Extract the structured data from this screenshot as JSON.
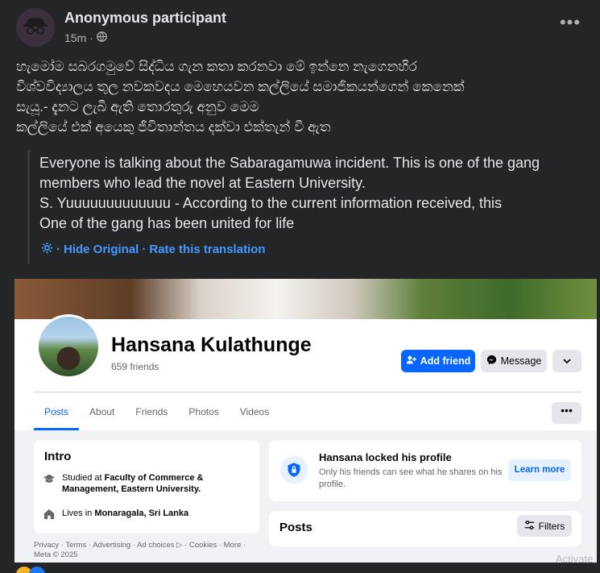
{
  "post": {
    "author": "Anonymous participant",
    "time": "15m",
    "separator": "·",
    "more_label": "•••",
    "text_lines": [
      "හැමෝම සබරගමුවේ සිද්ධිය ගැන කතා කරනවා මේ ඉන්නෙ නැගෙනහිර",
      "විශ්වවිද්‍යාලය තුල නවකවදය මෙහෙයවන කල්ලියේ සමාජිකයන්ගෙන් කෙනෙක්",
      "සැයූ.- දැනට ලැබී ඇති තොරතුරු අනුව මෙම",
      "කල්ලියේ එක් අයෙකු ජීවිතාන්තය දක්වා එක්තැන් වී ඇත"
    ],
    "translation_lines": [
      "Everyone is talking about the Sabaragamuwa incident. This is one of the gang",
      "members who lead the novel at Eastern University.",
      "S. Yuuuuuuuuuuuuu - According to the current information received, this",
      "One of the gang has been united for life"
    ],
    "hide_original": "Hide Original",
    "rate_translation": "Rate this translation"
  },
  "profile": {
    "name": "Hansana Kulathunge",
    "friends": "659 friends",
    "add_friend": "Add friend",
    "message": "Message",
    "tabs": [
      "Posts",
      "About",
      "Friends",
      "Photos",
      "Videos"
    ],
    "more_label": "•••",
    "intro": {
      "title": "Intro",
      "studied_prefix": "Studied at ",
      "studied_place_line1": "Faculty of Commerce &",
      "studied_place_line2": "Management, Eastern University.",
      "lives_prefix": "Lives in ",
      "lives_place": "Monaragala, Sri Lanka"
    },
    "locked": {
      "title": "Hansana locked his profile",
      "subtitle": "Only his friends can see what he shares on his profile.",
      "learn_more": "Learn more"
    },
    "posts": {
      "title": "Posts",
      "filters": "Filters"
    },
    "footer_line1": "Privacy · Terms · Advertising · Ad choices ▷ · Cookies · More ·",
    "footer_line2": "Meta © 2025"
  },
  "watermark": "Activate",
  "colors": {
    "accent": "#0866ff",
    "link": "#4599ff",
    "dark_bg": "#242526"
  }
}
